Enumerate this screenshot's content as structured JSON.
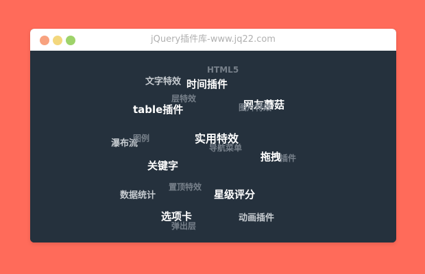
{
  "window": {
    "title": "jQuery插件库-www.jq22.com",
    "traffic_lights": {
      "close_color": "#F8A27F",
      "minimize_color": "#F3D77D",
      "maximize_color": "#9ED36A"
    }
  },
  "tag_cloud": {
    "tags": [
      {
        "label": "HTML5"
      },
      {
        "label": "文字特效"
      },
      {
        "label": "时间插件"
      },
      {
        "label": "层特效"
      },
      {
        "label": "table插件"
      },
      {
        "label": "网友蘑菇"
      },
      {
        "label": "图片特效"
      },
      {
        "label": "瀑布流"
      },
      {
        "label": "图例"
      },
      {
        "label": "实用特效"
      },
      {
        "label": "导航菜单"
      },
      {
        "label": "拖拽"
      },
      {
        "label": "插件"
      },
      {
        "label": "关键字"
      },
      {
        "label": "置顶特效"
      },
      {
        "label": "数据统计"
      },
      {
        "label": "星级评分"
      },
      {
        "label": "选项卡"
      },
      {
        "label": "动画插件"
      },
      {
        "label": "弹出层"
      }
    ]
  }
}
